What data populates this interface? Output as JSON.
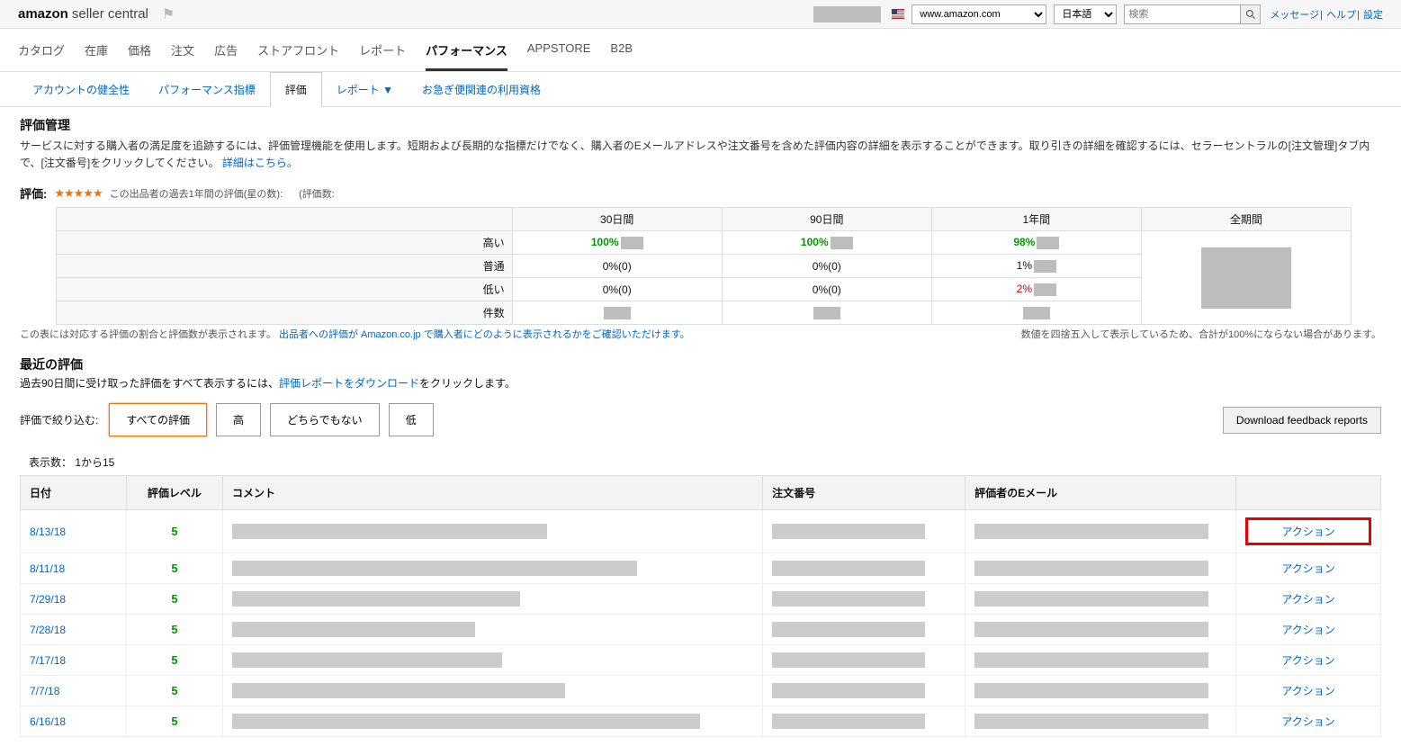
{
  "header": {
    "logo_brand": "amazon",
    "logo_sc": "seller central",
    "marketplace": "www.amazon.com",
    "language": "日本語",
    "search_placeholder": "検索",
    "links": {
      "messages": "メッセージ",
      "help": "ヘルプ",
      "settings": "設定"
    }
  },
  "main_nav": [
    "カタログ",
    "在庫",
    "価格",
    "注文",
    "広告",
    "ストアフロント",
    "レポート",
    "パフォーマンス",
    "APPSTORE",
    "B2B"
  ],
  "main_nav_active": 7,
  "sub_nav": [
    "アカウントの健全性",
    "パフォーマンス指標",
    "評価",
    "レポート ▼",
    "お急ぎ便関連の利用資格"
  ],
  "sub_nav_active": 2,
  "page": {
    "title": "評価管理",
    "desc_1": "サービスに対する購入者の満足度を追跡するには、評価管理機能を使用します。短期および長期的な指標だけでなく、購入者のEメールアドレスや注文番号を含めた評価内容の詳細を表示することができます。取り引きの詳細を確認するには、セラーセントラルの[注文管理]タブ内で、[注文番号]をクリックしてください。",
    "desc_link": "詳細はこちら。"
  },
  "rating": {
    "label": "評価:",
    "sub1": "この出品者の過去1年間の評価(星の数):",
    "sub2": "(評価数:"
  },
  "summary": {
    "periods": [
      "30日間",
      "90日間",
      "1年間",
      "全期間"
    ],
    "rows": [
      {
        "label": "高い",
        "cells": [
          "100%",
          "100%",
          "98%",
          ""
        ],
        "cls": "pct-green"
      },
      {
        "label": "普通",
        "cells": [
          "0%(0)",
          "0%(0)",
          "1%",
          ""
        ],
        "cls": ""
      },
      {
        "label": "低い",
        "cells": [
          "0%(0)",
          "0%(0)",
          "2%",
          ""
        ],
        "cls": "pct-red"
      },
      {
        "label": "件数",
        "cells": [
          "",
          "",
          "",
          ""
        ],
        "cls": ""
      }
    ],
    "foot_left_1": "この表には対応する評価の割合と評価数が表示されます。",
    "foot_left_link": "出品者への評価が Amazon.co.jp で購入者にどのように表示されるかをご確認いただけます。",
    "foot_right": "数値を四捨五入して表示しているため、合計が100%にならない場合があります。"
  },
  "recent": {
    "title": "最近の評価",
    "desc_a": "過去90日間に受け取った評価をすべて表示するには、",
    "desc_link": "評価レポートをダウンロード",
    "desc_b": "をクリックします。",
    "filter_label": "評価で絞り込む:",
    "filters": [
      "すべての評価",
      "高",
      "どちらでもない",
      "低"
    ],
    "filter_active": 0,
    "download_btn": "Download feedback reports",
    "count": "表示数： 1から15"
  },
  "fb_table": {
    "headers": {
      "date": "日付",
      "rating": "評価レベル",
      "comment": "コメント",
      "order": "注文番号",
      "email": "評価者のEメール",
      "action": ""
    },
    "rows": [
      {
        "date": "8/13/18",
        "rating": "5",
        "cw": 350,
        "action": "アクション",
        "hl": true
      },
      {
        "date": "8/11/18",
        "rating": "5",
        "cw": 450,
        "action": "アクション",
        "hl": false
      },
      {
        "date": "7/29/18",
        "rating": "5",
        "cw": 320,
        "action": "アクション",
        "hl": false
      },
      {
        "date": "7/28/18",
        "rating": "5",
        "cw": 270,
        "action": "アクション",
        "hl": false
      },
      {
        "date": "7/17/18",
        "rating": "5",
        "cw": 300,
        "action": "アクション",
        "hl": false
      },
      {
        "date": "7/7/18",
        "rating": "5",
        "cw": 370,
        "action": "アクション",
        "hl": false
      },
      {
        "date": "6/16/18",
        "rating": "5",
        "cw": 520,
        "action": "アクション",
        "hl": false
      }
    ]
  }
}
